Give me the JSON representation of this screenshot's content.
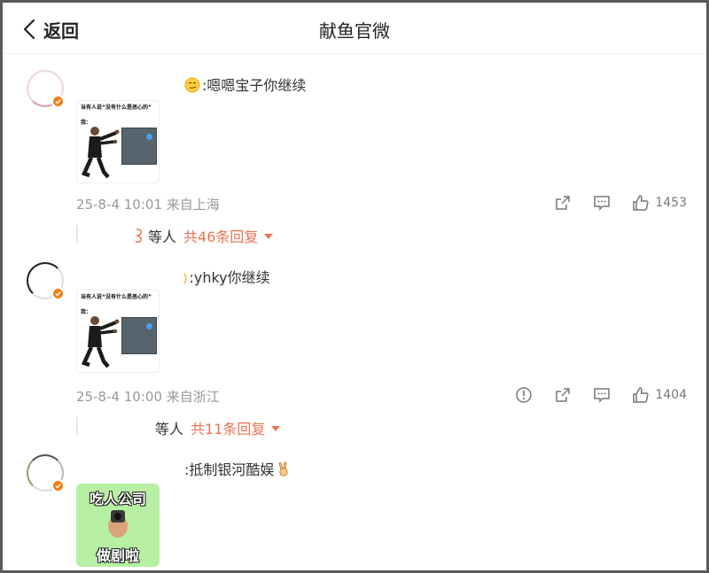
{
  "header": {
    "back_label": "返回",
    "title": "献鱼官微"
  },
  "comments": [
    {
      "text": ":嗯嗯宝子你继续",
      "meme_caption": "当有人说“没有什么是恶心的”",
      "meme_caption2": "我：",
      "time": "25-8-4 10:01",
      "location": "来自上海",
      "likes": "1453",
      "reply_etc": "等人",
      "reply_total": "共46条回复"
    },
    {
      "text": ":yhky你继续",
      "meme_caption": "当有人说“没有什么是恶心的”",
      "meme_caption2": "我：",
      "time": "25-8-4 10:00",
      "location": "来自浙江",
      "likes": "1404",
      "reply_etc": "等人",
      "reply_total": "共11条回复"
    },
    {
      "text": ":抵制银河酷娱",
      "meme_top": "吃人公司",
      "meme_bottom": "做剧啦"
    }
  ],
  "icons": {
    "back": "chevron-left-icon",
    "share": "share-icon",
    "comment": "comment-icon",
    "like": "thumb-up-icon",
    "report": "alert-circle-icon",
    "verified": "verified-badge-icon"
  },
  "colors": {
    "accent": "#eb7350",
    "verified": "#f07d15",
    "meta": "#999999"
  }
}
